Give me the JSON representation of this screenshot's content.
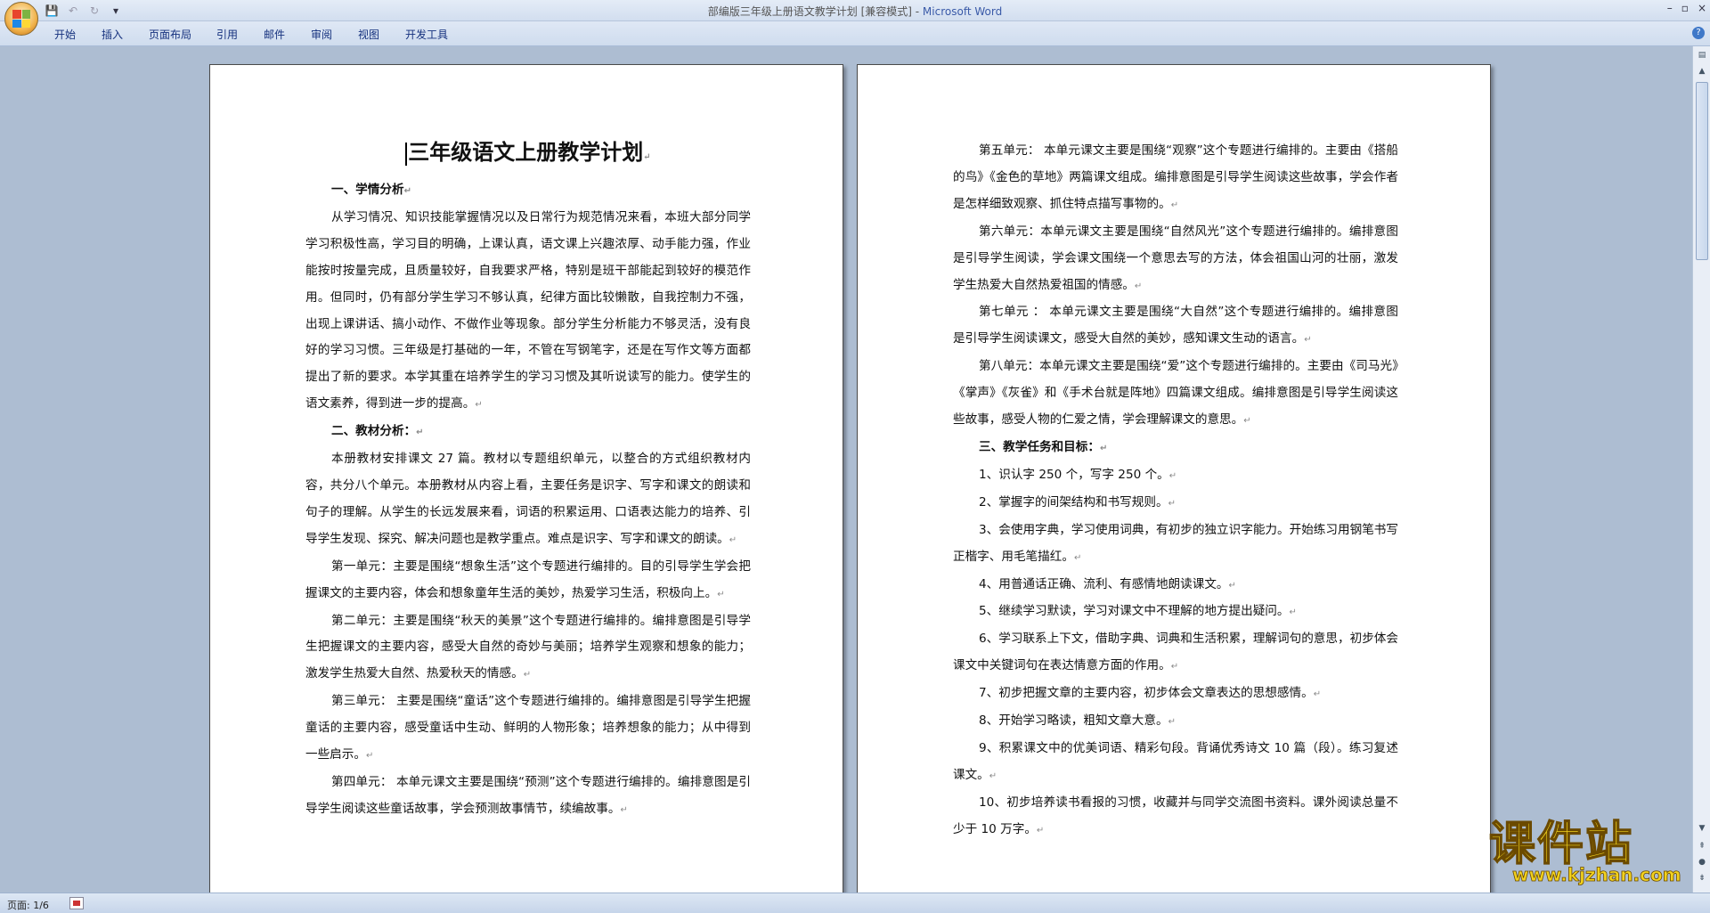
{
  "window": {
    "title_doc": "部编版三年级上册语文教学计划 [兼容模式] - ",
    "title_app": "Microsoft Word",
    "controls": [
      "–",
      "▫",
      "×"
    ]
  },
  "ribbon": {
    "tabs": [
      "开始",
      "插入",
      "页面布局",
      "引用",
      "邮件",
      "审阅",
      "视图",
      "开发工具"
    ],
    "help_label": "?"
  },
  "page1": {
    "title": "三年级语文上册教学计划",
    "paragraphs": [
      {
        "kind": "h",
        "text": "一、学情分析"
      },
      {
        "kind": "p",
        "text": "从学习情况、知识技能掌握情况以及日常行为规范情况来看，本班大部分同学学习积极性高，学习目的明确，上课认真，语文课上兴趣浓厚、动手能力强，作业能按时按量完成，且质量较好，自我要求严格，特别是班干部能起到较好的模范作用。但同时，仍有部分学生学习不够认真，纪律方面比较懒散，自我控制力不强，出现上课讲话、搞小动作、不做作业等现象。部分学生分析能力不够灵活，没有良好的学习习惯。三年级是打基础的一年，不管在写钢笔字，还是在写作文等方面都提出了新的要求。本学其重在培养学生的学习习惯及其听说读写的能力。使学生的语文素养，得到进一步的提高。"
      },
      {
        "kind": "h",
        "text": "二、教材分析："
      },
      {
        "kind": "p",
        "text": "本册教材安排课文 27 篇。教材以专题组织单元，以整合的方式组织教材内容，共分八个单元。本册教材从内容上看，主要任务是识字、写字和课文的朗读和句子的理解。从学生的长远发展来看，词语的积累运用、口语表达能力的培养、引导学生发现、探究、解决问题也是教学重点。难点是识字、写字和课文的朗读。"
      },
      {
        "kind": "p",
        "text": "第一单元：主要是围绕“想象生活”这个专题进行编排的。目的引导学生学会把握课文的主要内容，体会和想象童年生活的美妙，热爱学习生活，积极向上。"
      },
      {
        "kind": "p",
        "text": "第二单元：主要是围绕“秋天的美景”这个专题进行编排的。编排意图是引导学生把握课文的主要内容，感受大自然的奇妙与美丽；培养学生观察和想象的能力；激发学生热爱大自然、热爱秋天的情感。"
      },
      {
        "kind": "p",
        "text": "第三单元：  主要是围绕“童话”这个专题进行编排的。编排意图是引导学生把握童话的主要内容，感受童话中生动、鲜明的人物形象；培养想象的能力；从中得到一些启示。"
      },
      {
        "kind": "p",
        "text": "第四单元：  本单元课文主要是围绕“预测”这个专题进行编排的。编排意图是引导学生阅读这些童话故事，学会预测故事情节，续编故事。"
      }
    ]
  },
  "page2": {
    "paragraphs": [
      {
        "kind": "p",
        "text": "第五单元：  本单元课文主要是围绕“观察”这个专题进行编排的。主要由《搭船的鸟》《金色的草地》两篇课文组成。编排意图是引导学生阅读这些故事，学会作者是怎样细致观察、抓住特点描写事物的。"
      },
      {
        "kind": "p",
        "text": "第六单元：本单元课文主要是围绕“自然风光”这个专题进行编排的。编排意图是引导学生阅读，学会课文围绕一个意思去写的方法，体会祖国山河的壮丽，激发学生热爱大自然热爱祖国的情感。"
      },
      {
        "kind": "p",
        "text": "第七单元  ：  本单元课文主要是围绕“大自然”这个专题进行编排的。编排意图是引导学生阅读课文，感受大自然的美妙，感知课文生动的语言。"
      },
      {
        "kind": "p",
        "text": "第八单元：本单元课文主要是围绕“爱”这个专题进行编排的。主要由《司马光》《掌声》《灰雀》和《手术台就是阵地》四篇课文组成。编排意图是引导学生阅读这些故事，感受人物的仁爱之情，学会理解课文的意思。"
      },
      {
        "kind": "h",
        "text": "三、教学任务和目标："
      },
      {
        "kind": "p",
        "text": "1、识认字 250 个，写字 250 个。"
      },
      {
        "kind": "p",
        "text": "2、掌握字的间架结构和书写规则。"
      },
      {
        "kind": "p",
        "text": "3、会使用字典，学习使用词典，有初步的独立识字能力。开始练习用钢笔书写正楷字、用毛笔描红。"
      },
      {
        "kind": "p",
        "text": "4、用普通话正确、流利、有感情地朗读课文。"
      },
      {
        "kind": "p",
        "text": "5、继续学习默读，学习对课文中不理解的地方提出疑问。"
      },
      {
        "kind": "p",
        "text": "6、学习联系上下文，借助字典、词典和生活积累，理解词句的意思，初步体会课文中关键词句在表达情意方面的作用。"
      },
      {
        "kind": "p",
        "text": "7、初步把握文章的主要内容，初步体会文章表达的思想感情。"
      },
      {
        "kind": "p",
        "text": "8、开始学习略读，粗知文章大意。"
      },
      {
        "kind": "p",
        "text": "9、积累课文中的优美词语、精彩句段。背诵优秀诗文 10 篇（段）。练习复述课文。"
      },
      {
        "kind": "p",
        "text": "10、初步培养读书看报的习惯，收藏并与同学交流图书资料。课外阅读总量不少于 10 万字。"
      }
    ]
  },
  "paragraph_mark": "↵",
  "status": {
    "page_info": "页面: 1/6"
  },
  "watermark": {
    "text": "课件站",
    "url": "www.kjzhan.com"
  }
}
